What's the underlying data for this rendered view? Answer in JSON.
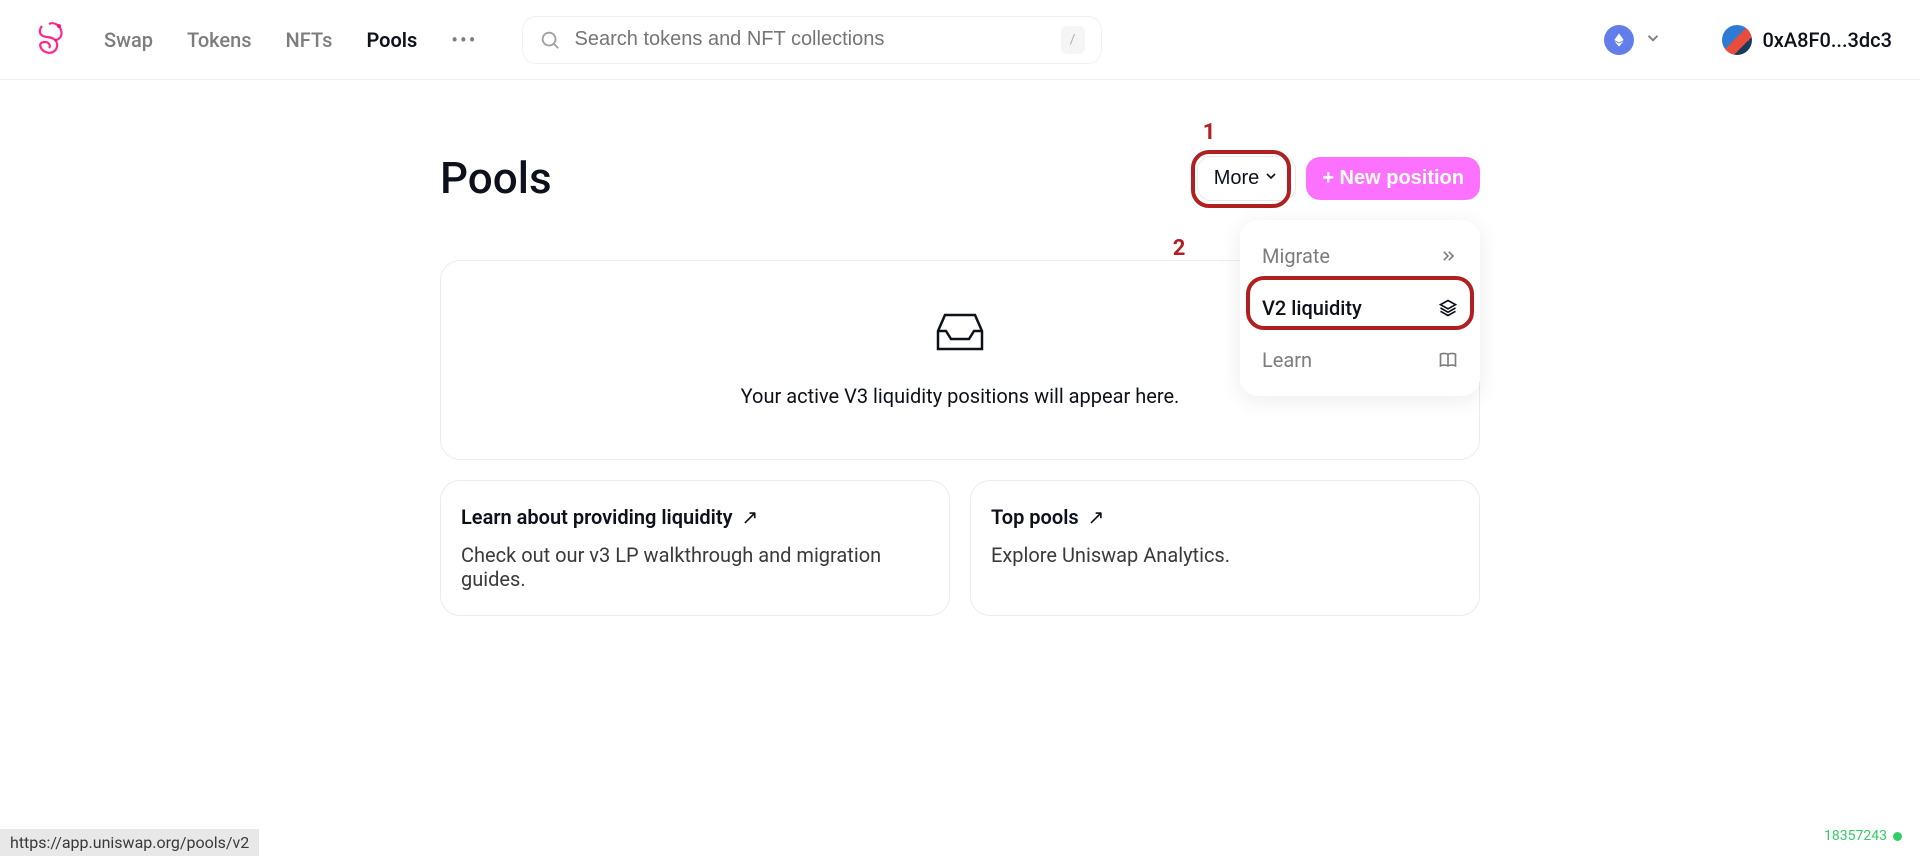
{
  "nav": {
    "items": [
      {
        "label": "Swap"
      },
      {
        "label": "Tokens"
      },
      {
        "label": "NFTs"
      },
      {
        "label": "Pools"
      }
    ]
  },
  "search": {
    "placeholder": "Search tokens and NFT collections",
    "kbd": "/"
  },
  "wallet": {
    "address": "0xA8F0...3dc3"
  },
  "page": {
    "title": "Pools",
    "more_label": "More",
    "new_position_label": "+ New position"
  },
  "dropdown": {
    "items": [
      {
        "label": "Migrate"
      },
      {
        "label": "V2 liquidity"
      },
      {
        "label": "Learn"
      }
    ]
  },
  "empty": {
    "text": "Your active V3 liquidity positions will appear here."
  },
  "cards": {
    "learn": {
      "title": "Learn about providing liquidity",
      "arrow": "↗",
      "sub": "Check out our v3 LP walkthrough and migration guides."
    },
    "top": {
      "title": "Top pools",
      "arrow": "↗",
      "sub": "Explore Uniswap Analytics."
    }
  },
  "annotations": {
    "one": "1",
    "two": "2"
  },
  "footer": {
    "url": "https://app.uniswap.org/pools/v2",
    "block": "18357243"
  }
}
